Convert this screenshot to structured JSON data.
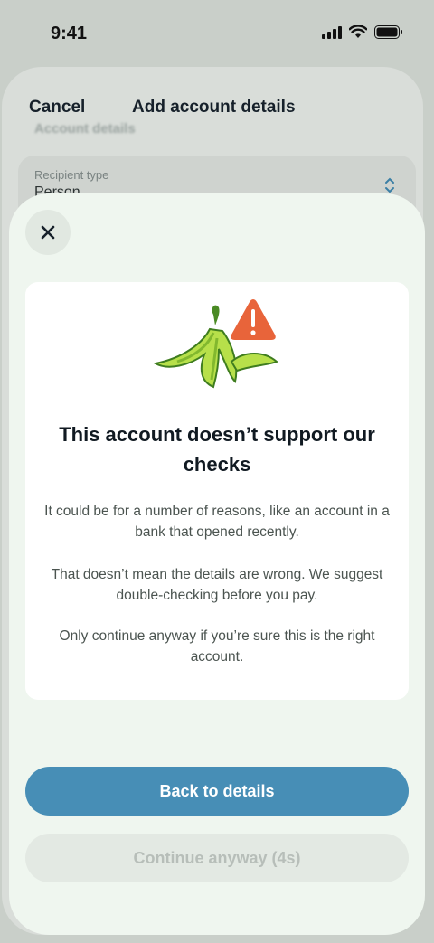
{
  "status_bar": {
    "time": "9:41"
  },
  "background_screen": {
    "cancel_label": "Cancel",
    "title": "Add account details",
    "section_heading": "Account details",
    "recipient_field": {
      "label": "Recipient type",
      "value": "Person"
    }
  },
  "modal": {
    "title": "This account doesn’t support our checks",
    "paragraphs": [
      "It could be for a number of reasons, like an account in a bank that opened recently.",
      "That doesn’t mean the details are wrong. We suggest double-checking before you pay.",
      "Only continue anyway if you’re sure this is the right account."
    ],
    "primary_button": "Back to details",
    "secondary_button": "Continue anyway (4s)"
  },
  "colors": {
    "primary": "#478eb6",
    "warning": "#e8643a",
    "sheet_background": "#eff6ef"
  },
  "icons": {
    "close": "close-icon",
    "illustration": "banana-peel-warning-illustration"
  }
}
